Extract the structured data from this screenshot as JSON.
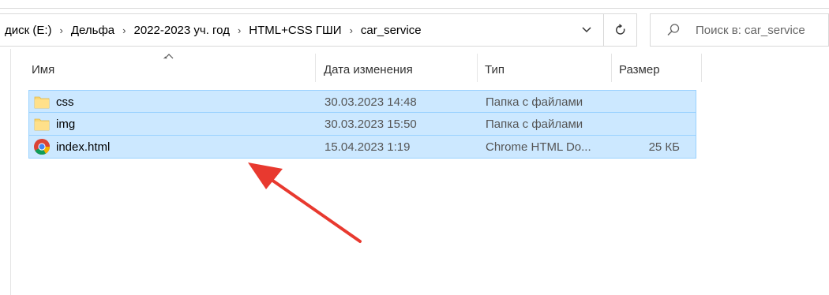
{
  "address_bar": {
    "breadcrumbs": [
      "диск (E:)",
      "Дельфа",
      "2022-2023 уч. год",
      "HTML+CSS ГШИ",
      "car_service"
    ]
  },
  "search": {
    "placeholder": "Поиск в: car_service"
  },
  "columns": {
    "name": "Имя",
    "date": "Дата изменения",
    "type": "Тип",
    "size": "Размер"
  },
  "files": [
    {
      "name": "css",
      "date": "30.03.2023 14:48",
      "type": "Папка с файлами",
      "size": "",
      "icon": "folder-icon"
    },
    {
      "name": "img",
      "date": "30.03.2023 15:50",
      "type": "Папка с файлами",
      "size": "",
      "icon": "folder-icon"
    },
    {
      "name": "index.html",
      "date": "15.04.2023 1:19",
      "type": "Chrome HTML Do...",
      "size": "25 КБ",
      "icon": "chrome-icon"
    }
  ],
  "colors": {
    "selection_bg": "#cce8ff",
    "selection_border": "#99d1ff",
    "folder": "#f8d775",
    "annotation_arrow": "#e8392f"
  }
}
